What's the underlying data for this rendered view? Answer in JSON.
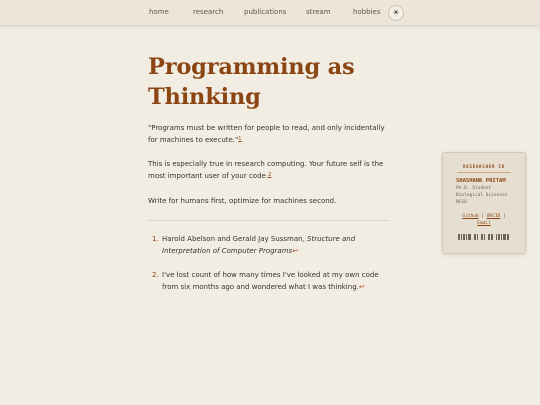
{
  "nav": {
    "items": [
      {
        "label": "home"
      },
      {
        "label": "research"
      },
      {
        "label": "publications"
      },
      {
        "label": "stream"
      },
      {
        "label": "hobbies"
      }
    ],
    "theme_toggle_symbol": "☀"
  },
  "article": {
    "title": "Programming as Thinking",
    "quote": "\"Programs must be written for people to read, and only incidentally for machines to execute.\"",
    "quote_ref": "1",
    "para2": "This is especially true in research computing. Your future self is the most important user of your code.",
    "para2_ref": "2",
    "para3": "Write for humans first, optimize for machines second."
  },
  "footnotes": [
    {
      "num": "1.",
      "authors": "Harold Abelson and Gerald Jay Sussman, ",
      "work": "Structure and Interpretation of Computer Programs",
      "backref": "↩"
    },
    {
      "num": "2.",
      "text": "I've lost count of how many times I've looked at my own code from six months ago and wondered what I was thinking.",
      "backref": "↩"
    }
  ],
  "card": {
    "heading": "RESEARCHER ID",
    "name": "SHASHANK PRITAM",
    "role": "Ph.D. Student",
    "dept": "Biological Sciences",
    "school": "NCSU",
    "links": {
      "github": "Github",
      "sep1": " | ",
      "orcid": "ORCID",
      "sep2": " |",
      "email": "Email"
    },
    "barcode_color": "#6e6457"
  },
  "colors": {
    "accent": "#8b4513",
    "background": "#f2ede3",
    "text": "#3a3128"
  }
}
